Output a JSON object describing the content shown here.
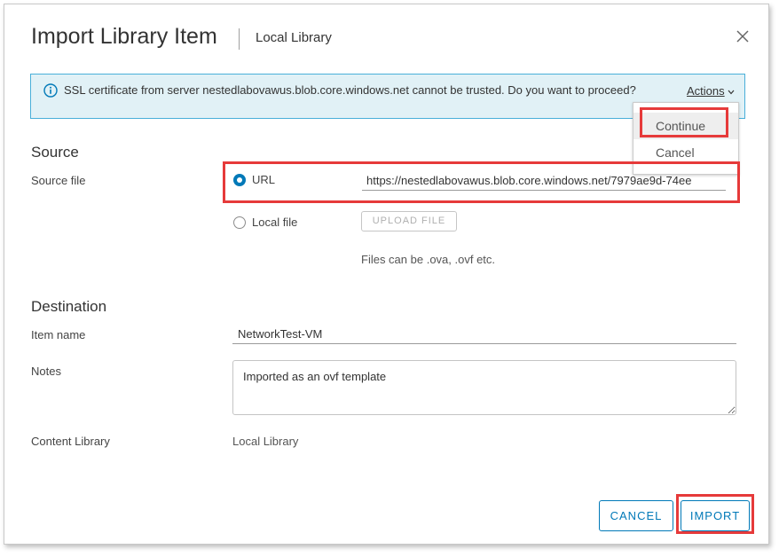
{
  "dialog": {
    "title": "Import Library Item",
    "subtitle": "Local Library",
    "close_icon": "close-icon"
  },
  "alert": {
    "icon": "info-icon",
    "message": "SSL certificate from server nestedlabovawus.blob.core.windows.net cannot be trusted. Do you want to proceed?",
    "actions_label": "Actions",
    "menu": {
      "continue": "Continue",
      "cancel": "Cancel"
    }
  },
  "source": {
    "heading": "Source",
    "file_label": "Source file",
    "url_option": "URL",
    "url_value": "https://nestedlabovawus.blob.core.windows.net/7979ae9d-74ee",
    "local_option": "Local file",
    "upload_label": "UPLOAD FILE",
    "hint": "Files can be .ova, .ovf etc.",
    "selected": "URL"
  },
  "destination": {
    "heading": "Destination",
    "item_name_label": "Item name",
    "item_name_value": "NetworkTest-VM",
    "notes_label": "Notes",
    "notes_value": "Imported as an ovf template",
    "library_label": "Content Library",
    "library_value": "Local Library"
  },
  "footer": {
    "cancel_label": "CANCEL",
    "import_label": "IMPORT"
  },
  "colors": {
    "accent": "#0079b8",
    "alert_bg": "#e1f1f6",
    "alert_border": "#49afd9",
    "highlight": "#e63a3a"
  }
}
